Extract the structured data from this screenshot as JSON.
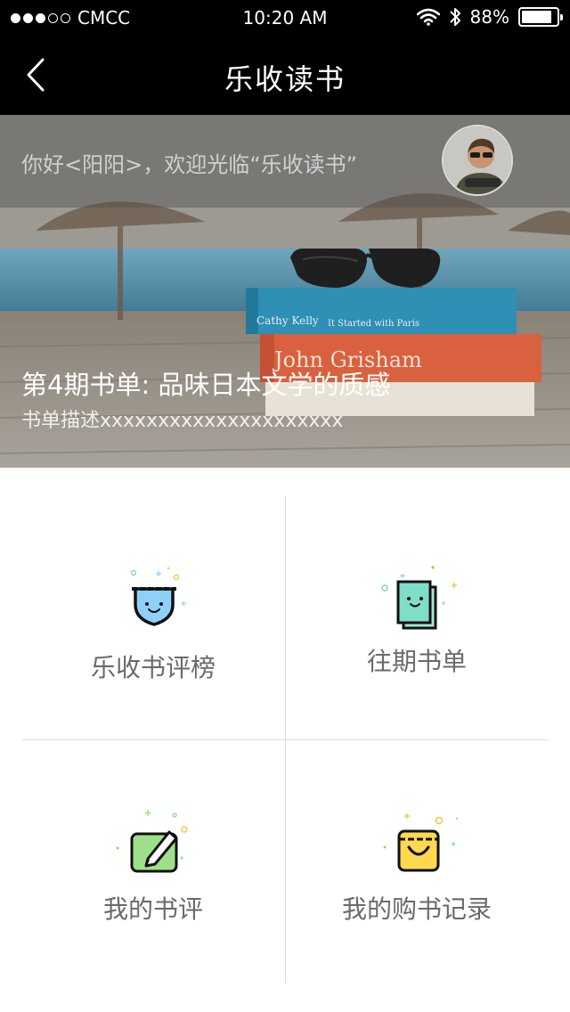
{
  "status_bar": {
    "carrier": "CMCC",
    "signal_filled": 3,
    "signal_total": 5,
    "time": "10:20 AM",
    "battery": "88%",
    "battery_level": 0.88
  },
  "nav": {
    "title": "乐收读书",
    "back_icon": "chevron-left-icon"
  },
  "hero": {
    "greeting": "你好<阳阳>，欢迎光临“乐收读书”",
    "list_title": "第4期书单: 品味日本文学的质感",
    "list_desc": "书单描述xxxxxxxxxxxxxxxxxxxxx"
  },
  "menu": [
    {
      "label": "乐收书评榜",
      "icon": "shield-badge-icon",
      "color": "#8fd0f8"
    },
    {
      "label": "往期书单",
      "icon": "book-stack-icon",
      "color": "#7edfc8"
    },
    {
      "label": "我的书评",
      "icon": "pencil-note-icon",
      "color": "#9ee08a"
    },
    {
      "label": "我的购书记录",
      "icon": "shopping-bag-icon",
      "color": "#ffd84f"
    }
  ]
}
